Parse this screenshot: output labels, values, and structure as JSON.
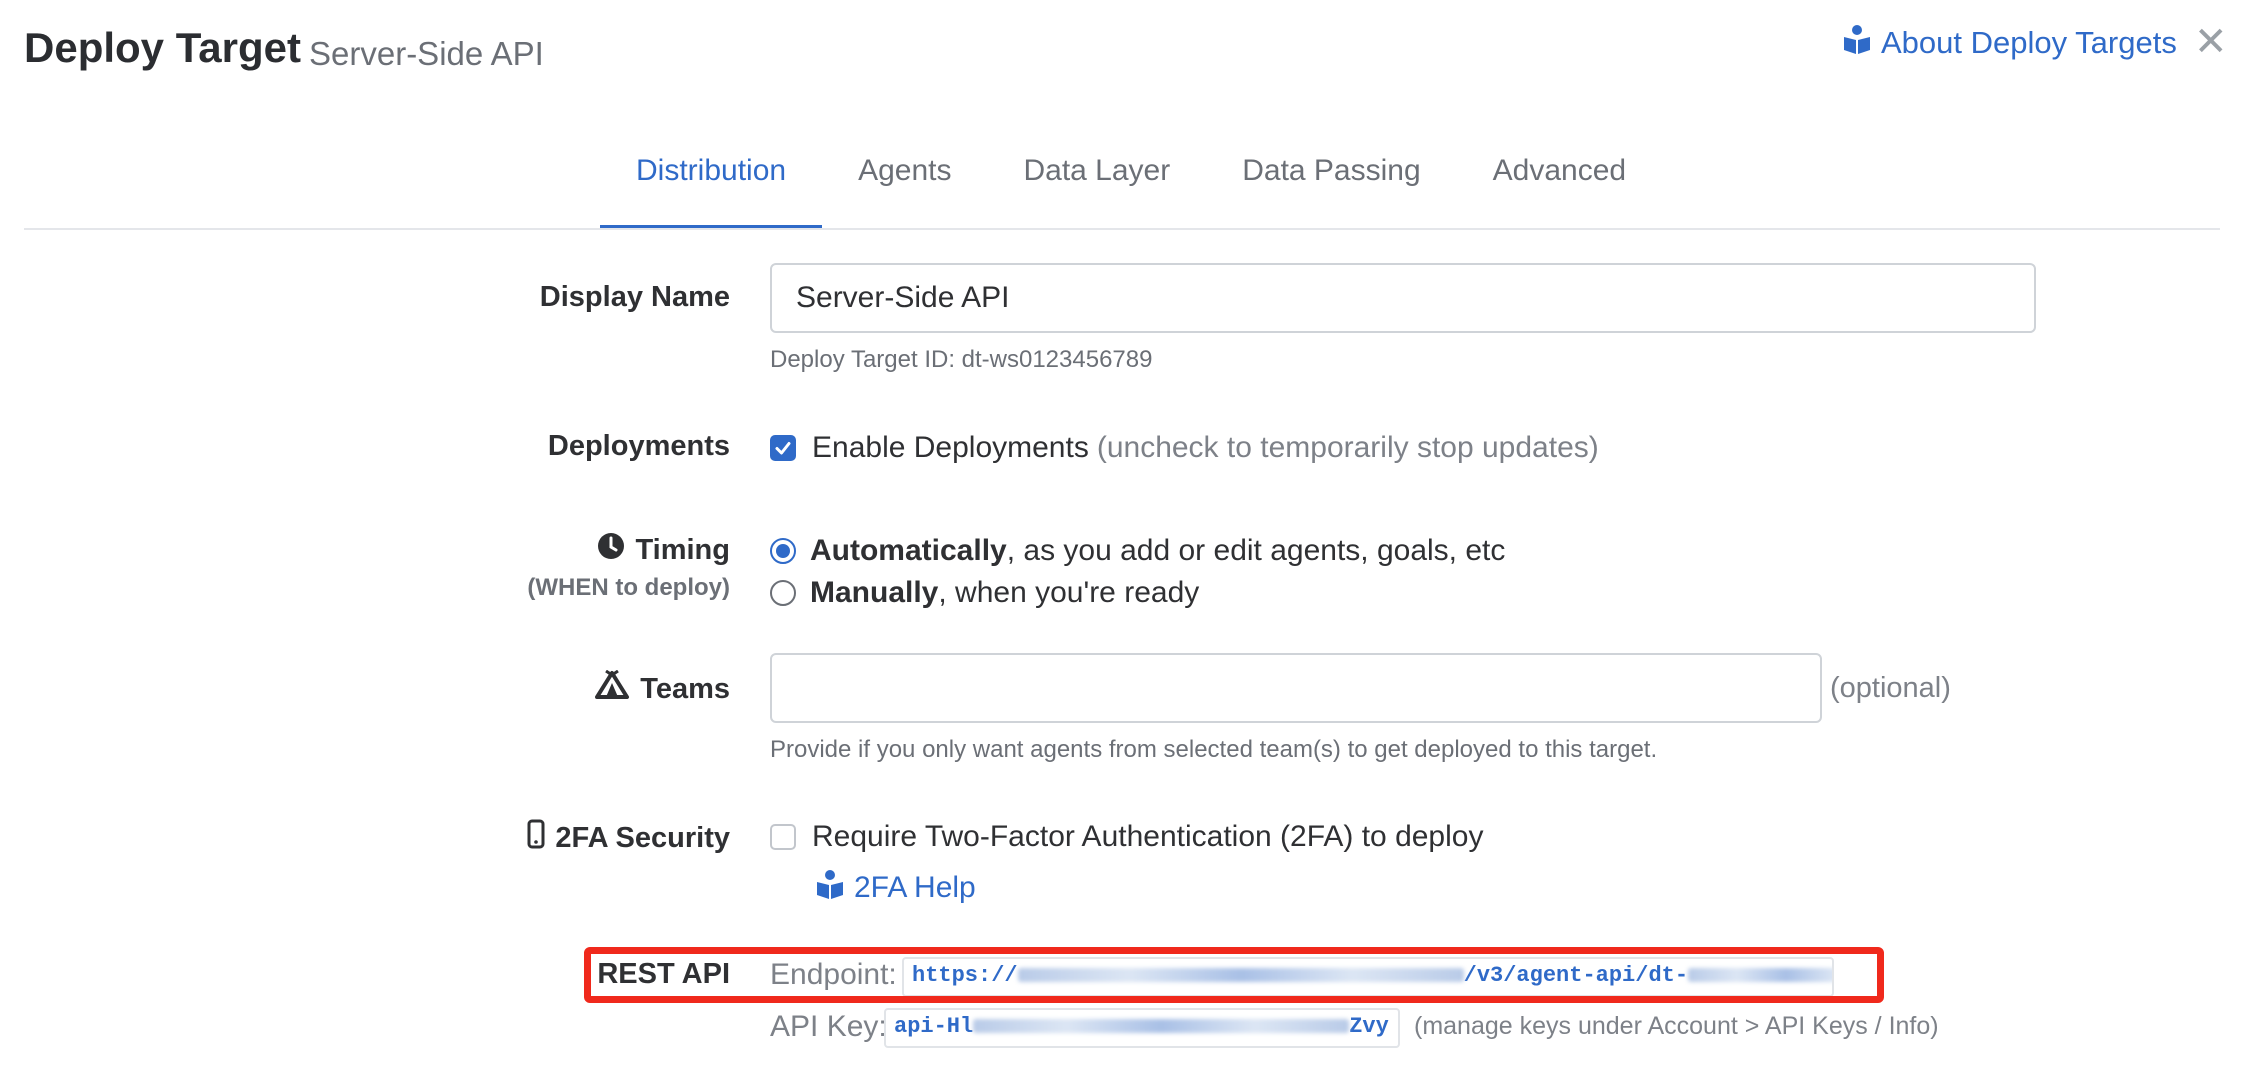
{
  "header": {
    "title": "Deploy Target",
    "subtitle": "Server-Side API",
    "about_link": "About Deploy Targets",
    "close_icon": "close-icon",
    "about_icon": "book-reader-icon"
  },
  "tabs": [
    {
      "label": "Distribution",
      "active": true
    },
    {
      "label": "Agents",
      "active": false
    },
    {
      "label": "Data Layer",
      "active": false
    },
    {
      "label": "Data Passing",
      "active": false
    },
    {
      "label": "Advanced",
      "active": false
    }
  ],
  "form": {
    "display_name": {
      "label": "Display Name",
      "value": "Server-Side API",
      "help": "Deploy Target ID: dt-ws0123456789"
    },
    "deployments": {
      "label": "Deployments",
      "checkbox_label": "Enable Deployments",
      "checkbox_note": "(uncheck to temporarily stop updates)",
      "checked": true
    },
    "timing": {
      "label": "Timing",
      "sublabel": "(WHEN to deploy)",
      "icon": "clock-icon",
      "options": [
        {
          "bold": "Automatically",
          "rest": ", as you add or edit agents, goals, etc",
          "selected": true
        },
        {
          "bold": "Manually",
          "rest": ", when you're ready",
          "selected": false
        }
      ]
    },
    "teams": {
      "label": "Teams",
      "icon": "tent-icon",
      "value": "",
      "optional": "(optional)",
      "help": "Provide if you only want agents from selected team(s) to get deployed to this target."
    },
    "security": {
      "label": "2FA Security",
      "icon": "mobile-phone-icon",
      "checkbox_label": "Require Two-Factor Authentication (2FA) to deploy",
      "checked": false,
      "help_link": "2FA Help"
    },
    "rest_api": {
      "label": "REST API",
      "endpoint_label": "Endpoint:",
      "endpoint_prefix": "https://",
      "endpoint_mid": "/v3/agent-api/dt-",
      "api_key_label": "API Key:",
      "api_key_prefix": "api-Hl",
      "api_key_suffix": "Zvy",
      "api_key_note": "(manage keys under Account > API Keys / Info)"
    }
  },
  "colors": {
    "accent": "#2f6ac8",
    "highlight": "#f0291c"
  }
}
